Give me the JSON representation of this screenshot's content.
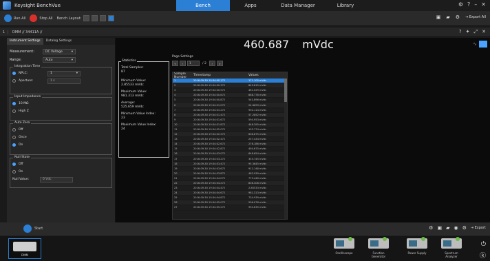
{
  "app": {
    "name": "Keysight BenchVue"
  },
  "topnav": [
    {
      "label": "Bench"
    },
    {
      "label": "Apps"
    },
    {
      "label": "Data Manager"
    },
    {
      "label": "Library"
    }
  ],
  "window_controls": [
    "gear-icon",
    "help-icon",
    "minimize-icon",
    "close-icon"
  ],
  "toolbar": {
    "run_all": "Run All",
    "stop_all": "Stop All",
    "bench_layout": "Bench Layout:",
    "export_all": "Export All"
  },
  "path": {
    "index": "1",
    "label": "DMM // 34411A //"
  },
  "panel": {
    "tabs": [
      "Instrument Settings",
      "Datalog Settings"
    ],
    "measurement": {
      "label": "Measurement:",
      "value": "DC Voltage"
    },
    "range": {
      "label": "Range:",
      "value": "Auto"
    },
    "integration_time": {
      "title": "Integration Time",
      "nplc": "NPLC:",
      "nplc_value": "1",
      "aperture": "Aperture:",
      "aperture_value": "1 s"
    },
    "input_impedance": {
      "title": "Input Impedance",
      "options": [
        "10 MΩ",
        "High Z"
      ]
    },
    "auto_zero": {
      "title": "Auto Zero",
      "options": [
        "Off",
        "Once",
        "On"
      ]
    },
    "null_state": {
      "title": "Null State",
      "options": [
        "Off",
        "On"
      ],
      "null_value_label": "Null Value:",
      "null_value": "0 Vdc"
    }
  },
  "reading": {
    "value": "460.687",
    "unit": "mVdc"
  },
  "statistics": {
    "title": "Statistics",
    "total_samples_label": "Total Samples:",
    "total_samples": "87",
    "minimum_label": "Minimum Value:",
    "minimum": "2.85533 mVdc",
    "maximum_label": "Maximum Value:",
    "maximum": "981.313 mVdc",
    "average_label": "Average:",
    "average": "525.659 mVdc",
    "min_index_label": "Minimum Value Index:",
    "min_index": "23",
    "max_index_label": "Maximum Value Index:",
    "max_index": "24"
  },
  "page_settings": {
    "title": "Page Settings",
    "current": "1",
    "total": "/ 2"
  },
  "table": {
    "headers": [
      "Sample Number",
      "Timestamp",
      "Values"
    ],
    "rows": [
      [
        "1",
        "2016-09-30 19:34:00.172",
        "171.105 mVdc"
      ],
      [
        "2",
        "2016-09-30 19:34:00.372",
        "849.815 mVdc"
      ],
      [
        "3",
        "2016-09-30 19:34:00.572",
        "461.029 mVdc"
      ],
      [
        "4",
        "2016-09-30 19:34:00.672",
        "868.776 mVdc"
      ],
      [
        "5",
        "2016-09-30 19:34:00.872",
        "540.896 mVdc"
      ],
      [
        "6",
        "2016-09-30 19:34:01.072",
        "24.6699 mVdc"
      ],
      [
        "7",
        "2016-09-30 19:34:01.272",
        "902.114 mVdc"
      ],
      [
        "8",
        "2016-09-30 19:34:01.472",
        "57.2852 mVdc"
      ],
      [
        "9",
        "2016-09-30 19:34:01.672",
        "594.953 mVdc"
      ],
      [
        "10",
        "2016-09-30 19:34:01.872",
        "448.395 mVdc"
      ],
      [
        "11",
        "2016-09-30 19:34:02.072",
        "133.774 mVdc"
      ],
      [
        "12",
        "2016-09-30 19:34:02.272",
        "608.875 mVdc"
      ],
      [
        "13",
        "2016-09-30 19:34:02.472",
        "257.434 mVdc"
      ],
      [
        "14",
        "2016-09-30 19:34:02.672",
        "276.186 mVdc"
      ],
      [
        "15",
        "2016-09-30 19:34:02.872",
        "494.675 mVdc"
      ],
      [
        "16",
        "2016-09-30 19:34:03.072",
        "648.654 mVdc"
      ],
      [
        "17",
        "2016-09-30 19:34:03.272",
        "355.745 mVdc"
      ],
      [
        "18",
        "2016-09-30 19:34:03.472",
        "95.3645 mVdc"
      ],
      [
        "19",
        "2016-09-30 19:34:03.672",
        "912.148 mVdc"
      ],
      [
        "20",
        "2016-09-30 19:34:03.872",
        "462.939 mVdc"
      ],
      [
        "21",
        "2016-09-30 19:34:04.072",
        "773.446 mVdc"
      ],
      [
        "22",
        "2016-09-30 19:34:04.272",
        "808.408 mVdc"
      ],
      [
        "23",
        "2016-09-30 19:34:04.472",
        "2.85533 mVdc"
      ],
      [
        "24",
        "2016-09-30 19:34:04.672",
        "981.313 mVdc"
      ],
      [
        "25",
        "2016-09-30 19:34:04.872",
        "734.939 mVdc"
      ],
      [
        "26",
        "2016-09-30 19:34:05.072",
        "506.076 mVdc"
      ],
      [
        "27",
        "2016-09-30 19:34:05.272",
        "994.635 mVdc"
      ]
    ]
  },
  "statusbar": {
    "start": "Start",
    "export": "Export"
  },
  "dock": {
    "device": "DMM",
    "instruments": [
      "Oscilloscope",
      "Function Generator",
      "Power Supply",
      "Spectrum Analyzer"
    ]
  },
  "colors": {
    "accent": "#2b7fd4",
    "stop": "#d9302a",
    "run": "#2b7fd4"
  }
}
